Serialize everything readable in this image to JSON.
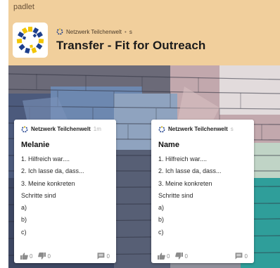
{
  "app": {
    "name": "padlet"
  },
  "header": {
    "author": "Netzwerk Teilchenwelt",
    "time": "s",
    "title": "Transfer - Fit for Outreach",
    "background": "#f1cf9c"
  },
  "posts": [
    {
      "author": "Netzwerk Teilchenwelt",
      "time": "1m",
      "title": "Melanie",
      "lines": [
        "1. Hilfreich war....",
        "2. Ich lasse da, dass...",
        "3. Meine konkreten",
        "Schritte sind",
        "a)",
        "b)",
        "c)"
      ],
      "likes": "0",
      "dislikes": "0",
      "comments": "0"
    },
    {
      "author": "Netzwerk Teilchenwelt",
      "time": "s",
      "title": "Name",
      "lines": [
        "1. Hilfreich war....",
        "2. Ich lasse da, dass...",
        "3. Meine konkreten",
        "Schritte sind",
        "a)",
        "b)",
        "c)"
      ],
      "likes": "0",
      "dislikes": "0",
      "comments": "0"
    }
  ],
  "icons": {
    "logo": "netzwerk-teilchenwelt-logo",
    "like": "thumbs-up-icon",
    "dislike": "thumbs-down-icon",
    "comment": "comment-icon"
  }
}
